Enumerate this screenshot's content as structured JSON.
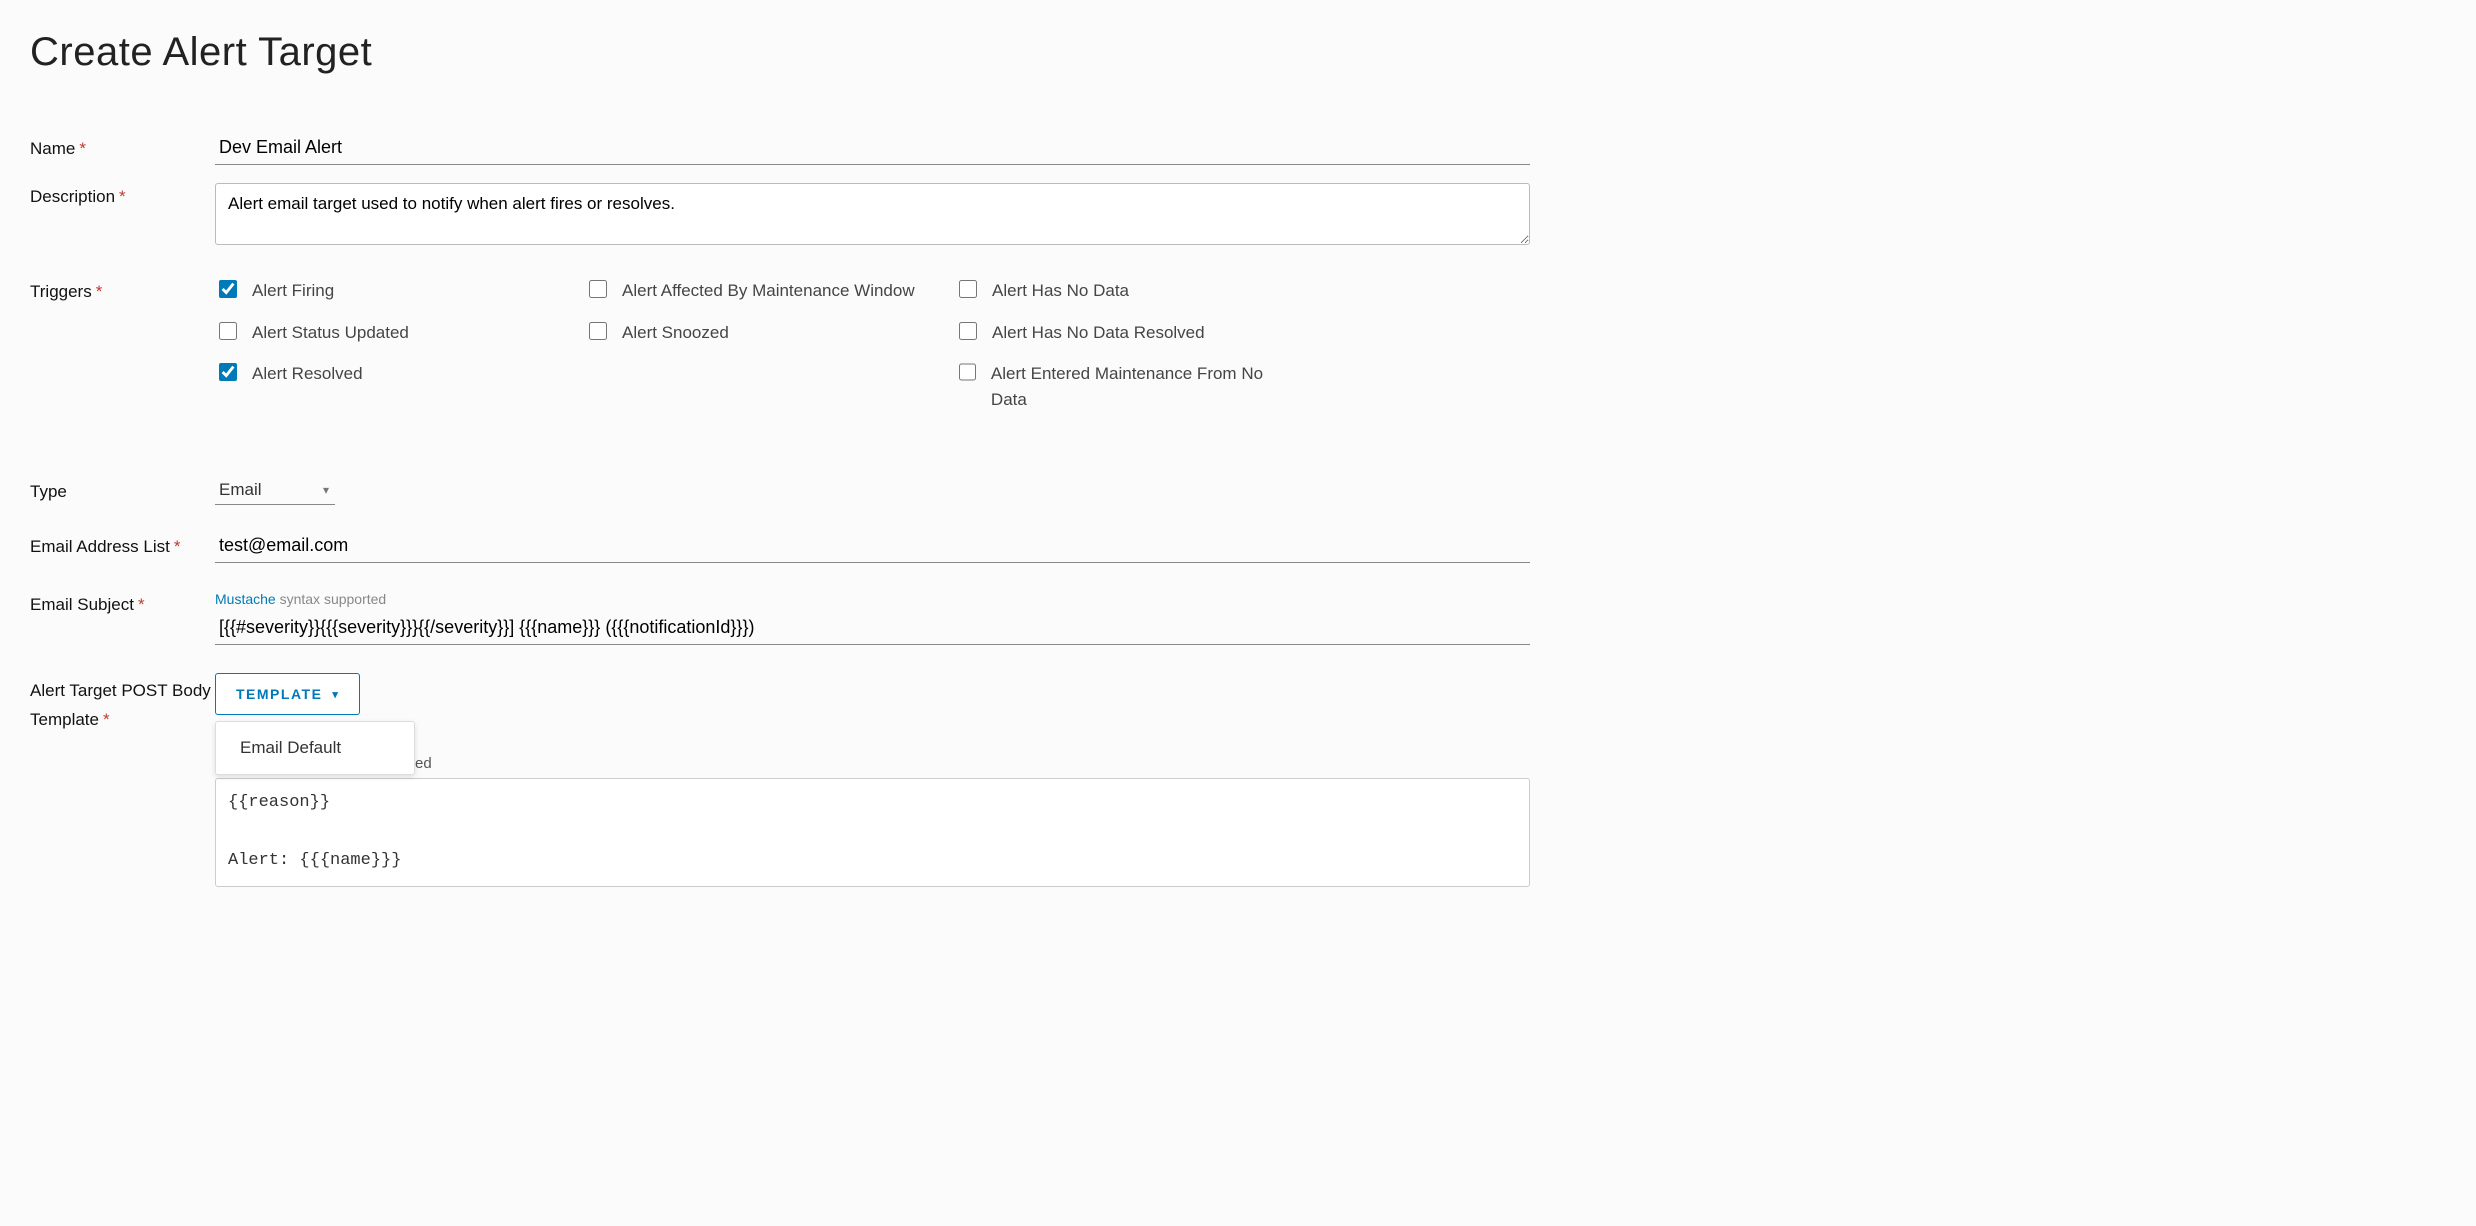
{
  "pageTitle": "Create Alert Target",
  "labels": {
    "name": "Name",
    "description": "Description",
    "triggers": "Triggers",
    "type": "Type",
    "emailList": "Email Address List",
    "emailSubject": "Email Subject",
    "bodyTemplate": "Alert Target POST Body Template"
  },
  "values": {
    "name": "Dev Email Alert",
    "description": "Alert email target used to notify when alert fires or resolves.",
    "type": "Email",
    "emailList": "test@email.com",
    "emailSubject": "[{{#severity}}{{{severity}}}{{/severity}}] {{{name}}} ({{{notificationId}}})",
    "bodyCode": "{{reason}}\n\nAlert: {{{name}}}"
  },
  "triggers": {
    "col1": [
      {
        "label": "Alert Firing",
        "checked": true
      },
      {
        "label": "Alert Status Updated",
        "checked": false
      },
      {
        "label": "Alert Resolved",
        "checked": true
      }
    ],
    "col2": [
      {
        "label": "Alert Affected By Maintenance Window",
        "checked": false
      },
      {
        "label": "Alert Snoozed",
        "checked": false
      }
    ],
    "col3": [
      {
        "label": "Alert Has No Data",
        "checked": false
      },
      {
        "label": "Alert Has No Data Resolved",
        "checked": false
      },
      {
        "label": "Alert Entered Maintenance From No Data",
        "checked": false
      }
    ]
  },
  "hints": {
    "mustacheLink": "Mustache",
    "mustacheText": " syntax supported",
    "bodyHintSuffix": "ed"
  },
  "templateButton": {
    "label": "Template",
    "options": [
      "Email Default"
    ]
  }
}
